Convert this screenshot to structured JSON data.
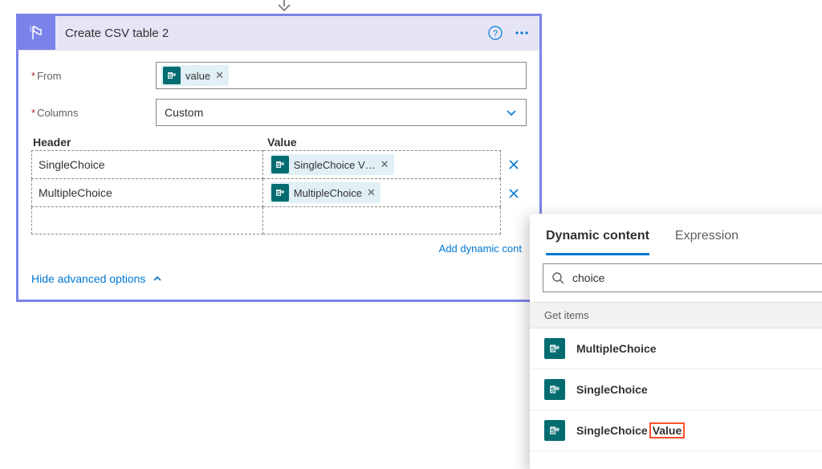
{
  "action": {
    "title": "Create CSV table 2",
    "fields": {
      "from_label": "From",
      "columns_label": "Columns",
      "columns_value": "Custom"
    },
    "from_token": "value",
    "grid": {
      "header_header": "Header",
      "value_header": "Value",
      "rows": [
        {
          "header": "SingleChoice",
          "value_token": "SingleChoice V…"
        },
        {
          "header": "MultipleChoice",
          "value_token": "MultipleChoice"
        }
      ]
    },
    "add_dynamic_label": "Add dynamic cont",
    "hide_advanced_label": "Hide advanced options"
  },
  "dc_panel": {
    "tabs": {
      "dynamic": "Dynamic content",
      "expression": "Expression"
    },
    "search_value": "choice",
    "section_label": "Get items",
    "items": [
      {
        "label": "MultipleChoice",
        "highlight_suffix": null
      },
      {
        "label": "SingleChoice",
        "highlight_suffix": null
      },
      {
        "label": "SingleChoice",
        "highlight_suffix": "Value"
      }
    ]
  }
}
